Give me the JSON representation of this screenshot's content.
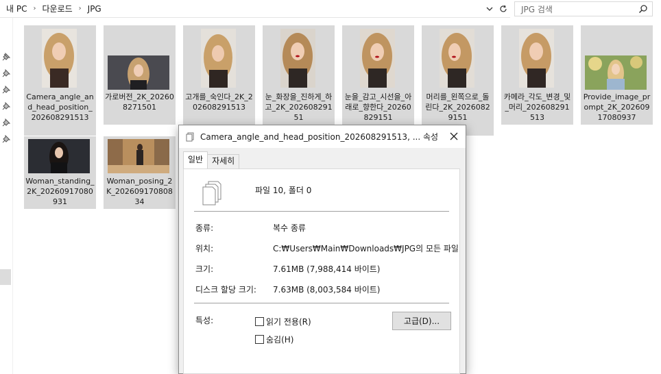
{
  "address_bar": {
    "crumbs": [
      "내 PC",
      "다운로드",
      "JPG"
    ]
  },
  "search": {
    "placeholder": "JPG 검색"
  },
  "files": [
    {
      "name": "Camera_angle_and_head_position_202608291513"
    },
    {
      "name": "가로버전_2K_202608271501"
    },
    {
      "name": "고개를_숙인다_2K_202608291513"
    },
    {
      "name": "눈_화장을_진하게_하고_2K_20260829151"
    },
    {
      "name": "눈을_감고_시선을_아래로_향한다_20260829151"
    },
    {
      "name": "머리를_왼쪽으로_돌린다_2K_20260829151"
    },
    {
      "name": "카메라_각도_변경_및_머리_202608291513"
    },
    {
      "name": "Provide_image_prompt_2K_20260917080937"
    },
    {
      "name": "Woman_standing_2K_20260917080931"
    },
    {
      "name": "Woman_posing_2K_20260917080834"
    }
  ],
  "dialog": {
    "title": "Camera_angle_and_head_position_202608291513, ... 속성",
    "tabs": [
      "일반",
      "자세히"
    ],
    "summary": "파일 10, 폴더 0",
    "properties": [
      {
        "label": "종류:",
        "value": "복수 종류"
      },
      {
        "label": "위치:",
        "value": "C:₩Users₩Main₩Downloads₩JPG의 모든 파일"
      },
      {
        "label": "크기:",
        "value": "7.61MB (7,988,414 바이트)"
      },
      {
        "label": "디스크 할당 크기:",
        "value": "7.63MB (8,003,584 바이트)"
      }
    ],
    "attributes_label": "특성:",
    "readonly_label": "읽기 전용(R)",
    "hidden_label": "숨김(H)",
    "advanced_button": "고급(D)..."
  },
  "icons": [
    "chevron-down-icon",
    "refresh-icon",
    "search-icon",
    "pin-icon",
    "close-icon",
    "files-icon"
  ]
}
